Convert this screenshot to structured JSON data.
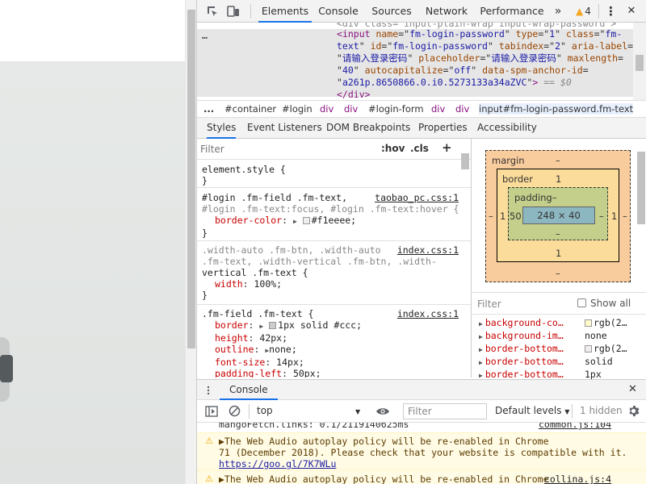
{
  "devtools": {
    "tabs": [
      "Elements",
      "Console",
      "Sources",
      "Network",
      "Performance"
    ],
    "more_tabs_glyph": "»",
    "warning_count": "4",
    "menu_glyph": "⋮",
    "close_glyph": "✕"
  },
  "elements": {
    "ellipsis": "…",
    "partial_line": "<div class=\"input-plain-wrap input-wrap-password\">",
    "input_tag": "input",
    "attrs": [
      {
        "n": "name",
        "v": "fm-login-password"
      },
      {
        "n": "type",
        "v": "1"
      },
      {
        "n": "class",
        "v": "fm-text"
      },
      {
        "n": "id",
        "v": "fm-login-password"
      },
      {
        "n": "tabindex",
        "v": "2"
      },
      {
        "n": "aria-label",
        "v": "请输入登录密码"
      },
      {
        "n": "placeholder",
        "v": "请输入登录密码"
      },
      {
        "n": "maxlength",
        "v": "40"
      },
      {
        "n": "autocapitalize",
        "v": "off"
      },
      {
        "n": "data-spm-anchor-id",
        "v": "a261p.8650866.0.i0.5273133a34aZVC"
      }
    ],
    "eq_marker": "== $0",
    "closing": "</div>"
  },
  "breadcrumb": [
    "...",
    "#container",
    "#login",
    "div",
    "div",
    "#login-form",
    "div",
    "div",
    "input#fm-login-password.fm-text"
  ],
  "subtabs": [
    "Styles",
    "Event Listeners",
    "DOM Breakpoints",
    "Properties",
    "Accessibility"
  ],
  "styles": {
    "filter_placeholder": "Filter",
    "hov": ":hov",
    "cls": ".cls",
    "plus": "+",
    "rules": [
      {
        "selector": "element.style {",
        "props": [],
        "source": "",
        "close": "}"
      },
      {
        "selector": "#login .fm-field .fm-text,",
        "selector2": "#login .fm-text:focus, #login .fm-text:hover {",
        "source": "taobao_pc.css:1",
        "props": [
          {
            "n": "border-color",
            "v": "#f1eeee;",
            "swatch": "#f1eeee"
          }
        ],
        "close": "}"
      },
      {
        "selector": ".width-auto .fm-btn, .width-auto",
        "selector2": ".fm-text, .width-vertical .fm-btn, .width-",
        "selector3": "vertical .fm-text {",
        "source": "index.css:1",
        "props": [
          {
            "n": "width",
            "v": "100%;"
          }
        ],
        "close": "}"
      },
      {
        "selector": ".fm-field .fm-text {",
        "source": "index.css:1",
        "props": [
          {
            "n": "border",
            "v": "1px solid #ccc;",
            "swatch": "#cccccc"
          },
          {
            "n": "height",
            "v": "42px;"
          },
          {
            "n": "outline",
            "v": "none;"
          },
          {
            "n": "font-size",
            "v": "14px;"
          },
          {
            "n": "padding-left",
            "v": "50px;"
          }
        ]
      }
    ]
  },
  "boxmodel": {
    "margin_label": "margin",
    "margin_top": "–",
    "margin_bottom": "–",
    "margin_left": "–",
    "margin_right": "–",
    "border_label": "border",
    "border_top": "1",
    "border_bottom": "1",
    "border_left": "1",
    "border_right": "1",
    "padding_label": "padding–",
    "padding_bottom": "–",
    "padding_left": "50",
    "padding_right": "–",
    "content": "248 × 40"
  },
  "computed": {
    "filter_placeholder": "Filter",
    "show_all": "Show all",
    "rows": [
      {
        "n": "background-co…",
        "v": "rgb(2…",
        "swatch": "#fffbcc"
      },
      {
        "n": "background-im…",
        "v": "none"
      },
      {
        "n": "border-bottom…",
        "v": "rgb(2…",
        "swatch": "#f1eeee"
      },
      {
        "n": "border-bottom…",
        "v": "solid"
      },
      {
        "n": "border-bottom…",
        "v": "1px"
      }
    ]
  },
  "console": {
    "drawer_tab": "Console",
    "context": "top",
    "filter_placeholder": "Filter",
    "levels": "Default levels",
    "hidden": "1 hidden",
    "messages": [
      {
        "type": "log",
        "text": "mangoFetch.links: 0.1/2119140625ms",
        "source": "common.js:104"
      },
      {
        "type": "warn",
        "line1": "▶The Web Audio autoplay policy will be re-enabled in Chrome",
        "line2": "71 (December 2018). Please check that your website is compatible with it.",
        "url": "https://goo.gl/7K7WLu",
        "source": ""
      },
      {
        "type": "warn",
        "line1": "▶The Web Audio autoplay policy will be re-enabled in Chrome",
        "source": "collina.js:4"
      }
    ]
  },
  "colors": {
    "accent": "#1a73e8",
    "tag": "#881280",
    "attr": "#994500",
    "value": "#1a1aa6",
    "prop": "#c80000"
  }
}
